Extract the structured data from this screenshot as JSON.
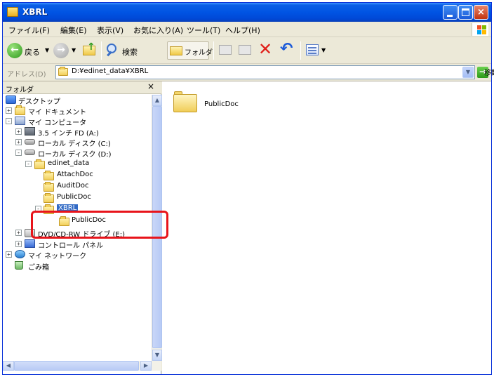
{
  "window": {
    "title": "XBRL",
    "buttons": {
      "minimize": "minimize",
      "maximize": "maximize",
      "close": "×"
    }
  },
  "menubar": {
    "items": [
      "ファイル(F)",
      "編集(E)",
      "表示(V)",
      "お気に入り(A)",
      "ツール(T)",
      "ヘルプ(H)"
    ]
  },
  "toolbar": {
    "back_label": "戻る",
    "search_label": "検索",
    "folders_label": "フォルダ"
  },
  "address": {
    "label": "アドレス(D)",
    "value": "D:¥edinet_data¥XBRL",
    "go_label": "移動"
  },
  "folders_pane": {
    "title": "フォルダ",
    "close": "×",
    "tree": [
      {
        "label": "デスクトップ",
        "icon": "desktop-icon"
      },
      {
        "label": "マイ ドキュメント",
        "icon": "my-documents-icon"
      },
      {
        "label": "マイ コンピュータ",
        "icon": "my-computer-icon"
      },
      {
        "label": "3.5 インチ FD (A:)",
        "icon": "floppy-icon"
      },
      {
        "label": "ローカル ディスク (C:)",
        "icon": "hard-disk-icon"
      },
      {
        "label": "ローカル ディスク (D:)",
        "icon": "hard-disk-icon"
      },
      {
        "label": "edinet_data",
        "icon": "folder-open-icon"
      },
      {
        "label": "AttachDoc",
        "icon": "folder-icon"
      },
      {
        "label": "AuditDoc",
        "icon": "folder-icon"
      },
      {
        "label": "PublicDoc",
        "icon": "folder-icon"
      },
      {
        "label": "XBRL",
        "icon": "folder-open-icon",
        "selected": true
      },
      {
        "label": "PublicDoc",
        "icon": "folder-icon"
      },
      {
        "label": "DVD/CD-RW ドライブ (E:)",
        "icon": "dvd-drive-icon"
      },
      {
        "label": "コントロール パネル",
        "icon": "control-panel-icon"
      },
      {
        "label": "マイ ネットワーク",
        "icon": "network-icon"
      },
      {
        "label": "ごみ箱",
        "icon": "recycle-bin-icon"
      }
    ]
  },
  "content": {
    "items": [
      {
        "label": "PublicDoc",
        "icon": "folder-icon"
      }
    ]
  },
  "colors": {
    "titlebar": "#0054e3",
    "highlight": "#e8141b",
    "selection": "#316ac5"
  }
}
